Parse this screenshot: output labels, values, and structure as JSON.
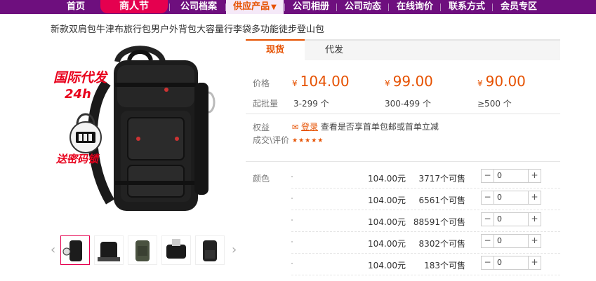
{
  "nav": {
    "items": [
      {
        "label": "首页"
      },
      {
        "label": "商人节"
      },
      {
        "label": "公司档案"
      },
      {
        "label": "供应产品"
      },
      {
        "label": "公司相册"
      },
      {
        "label": "公司动态"
      },
      {
        "label": "在线询价"
      },
      {
        "label": "联系方式"
      },
      {
        "label": "会员专区"
      }
    ],
    "active_caret": "▼"
  },
  "product": {
    "title": "新款双肩包牛津布旅行包男户外背包大容量行李袋多功能徒步登山包",
    "image_badge_line1": "国际代发",
    "image_badge_line2": "24h",
    "image_badge_line3": "送密码锁"
  },
  "tabs": [
    {
      "label": "现货"
    },
    {
      "label": "代发"
    }
  ],
  "pricing": {
    "price_label": "价格",
    "moq_label": "起批量",
    "currency": "¥",
    "tiers": [
      {
        "price": "104.00",
        "range": "3-299 个"
      },
      {
        "price": "99.00",
        "range": "300-499 个"
      },
      {
        "price": "90.00",
        "range": "≥500 个"
      }
    ]
  },
  "benefits": {
    "label": "权益",
    "login_link": "登录",
    "text": "查看是否享首单包邮或首单立减"
  },
  "reviews": {
    "label": "成交\\评价",
    "stars": "★★★★★"
  },
  "sku": {
    "color_label": "颜色",
    "rows": [
      {
        "price": "104.00元",
        "stock": "3717个可售",
        "qty": "0"
      },
      {
        "price": "104.00元",
        "stock": "6561个可售",
        "qty": "0"
      },
      {
        "price": "104.00元",
        "stock": "88591个可售",
        "qty": "0"
      },
      {
        "price": "104.00元",
        "stock": "8302个可售",
        "qty": "0"
      },
      {
        "price": "104.00元",
        "stock": "183个可售",
        "qty": "0"
      }
    ],
    "minus": "−",
    "plus": "+"
  },
  "thumbs": {
    "prev": "‹",
    "next": "›"
  }
}
